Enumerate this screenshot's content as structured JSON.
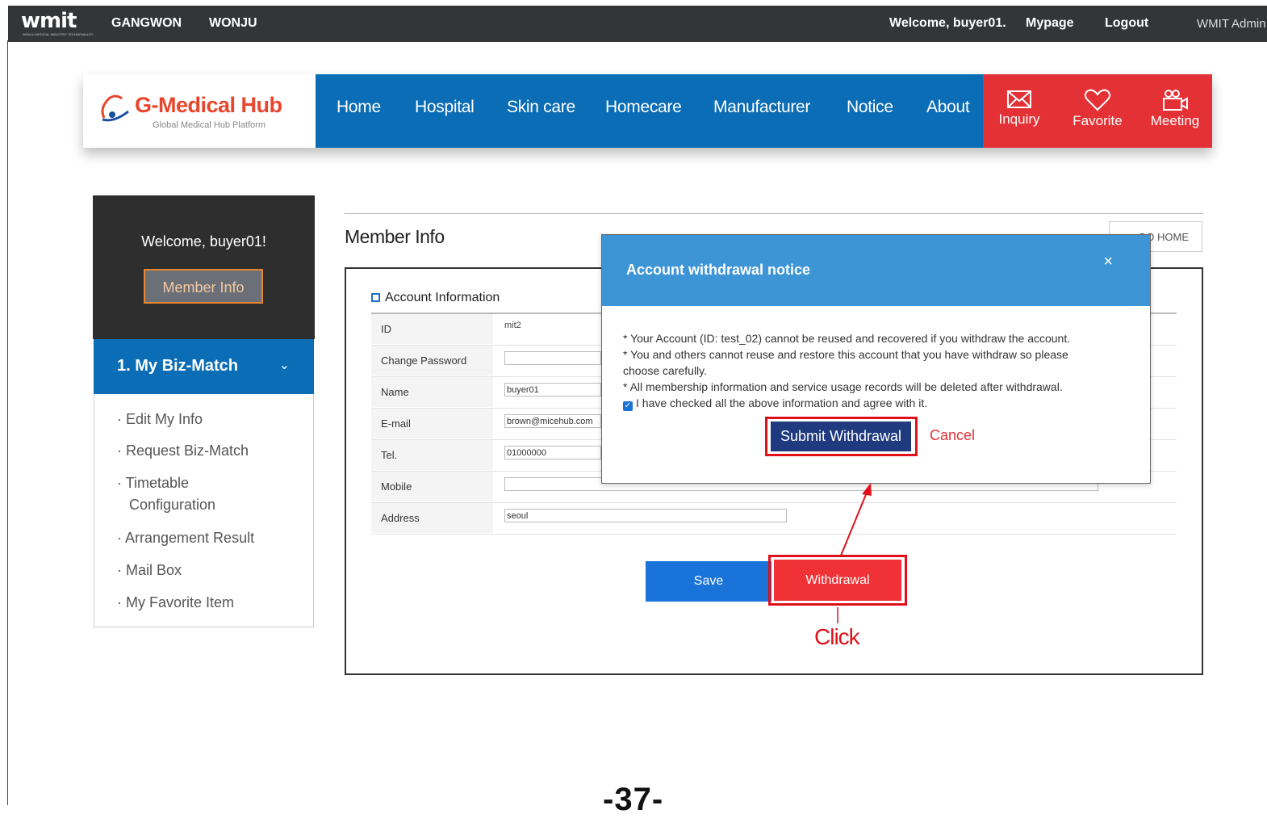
{
  "topbar": {
    "logo": "wmit",
    "logo_sub": "WONJU MEDICAL INDUSTRY TECHNOVALLEY",
    "region1": "GANGWON",
    "region2": "WONJU",
    "welcome": "Welcome, buyer01.",
    "mypage": "Mypage",
    "logout": "Logout",
    "admin": "WMIT Admin"
  },
  "brand": {
    "name": "G-Medical Hub",
    "tagline": "Global Medical Hub Platform"
  },
  "nav": [
    "Home",
    "Hospital",
    "Skin care",
    "Homecare",
    "Manufacturer",
    "Notice",
    "About"
  ],
  "quick": [
    "Inquiry",
    "Favorite",
    "Meeting"
  ],
  "sidebar": {
    "welcome": "Welcome, buyer01!",
    "member_info": "Member Info",
    "menu_title": "1. My Biz-Match",
    "links": [
      "· Edit My Info",
      "· Request Biz-Match",
      "· Timetable",
      "Configuration",
      "· Arrangement Result",
      "· Mail Box",
      "· My Favorite Item"
    ]
  },
  "content": {
    "title": "Member Info",
    "go_home": "GO HOME",
    "section": "Account Information",
    "rows": [
      {
        "label": "ID",
        "value": "mit2"
      },
      {
        "label": "Change Password",
        "value": ""
      },
      {
        "label": "Name",
        "value": "buyer01"
      },
      {
        "label": "E-mail",
        "value": "brown@micehub.com"
      },
      {
        "label": "Tel.",
        "value": "01000000"
      },
      {
        "label": "Mobile",
        "value": ""
      },
      {
        "label": "Address",
        "value": "seoul"
      }
    ],
    "save": "Save",
    "withdrawal": "Withdrawal",
    "click": "Click"
  },
  "modal": {
    "title": "Account withdrawal notice",
    "close": "×",
    "line1": "* Your Account (ID: test_02) cannot be reused and recovered if you withdraw the account.",
    "line2": "* You and others cannot reuse and restore this account that you have withdraw so please",
    "line3": "choose carefully.",
    "line4": "* All membership information and service usage records will be deleted after withdrawal.",
    "agree": "I have checked all the above information and agree with it.",
    "submit": "Submit Withdrawal",
    "cancel": "Cancel"
  },
  "page_number": "-37-",
  "colors": {
    "nav_blue": "#0b6db5",
    "quick_red": "#e33135",
    "annotation_red": "#e0101a",
    "modal_header": "#3d95d6"
  }
}
